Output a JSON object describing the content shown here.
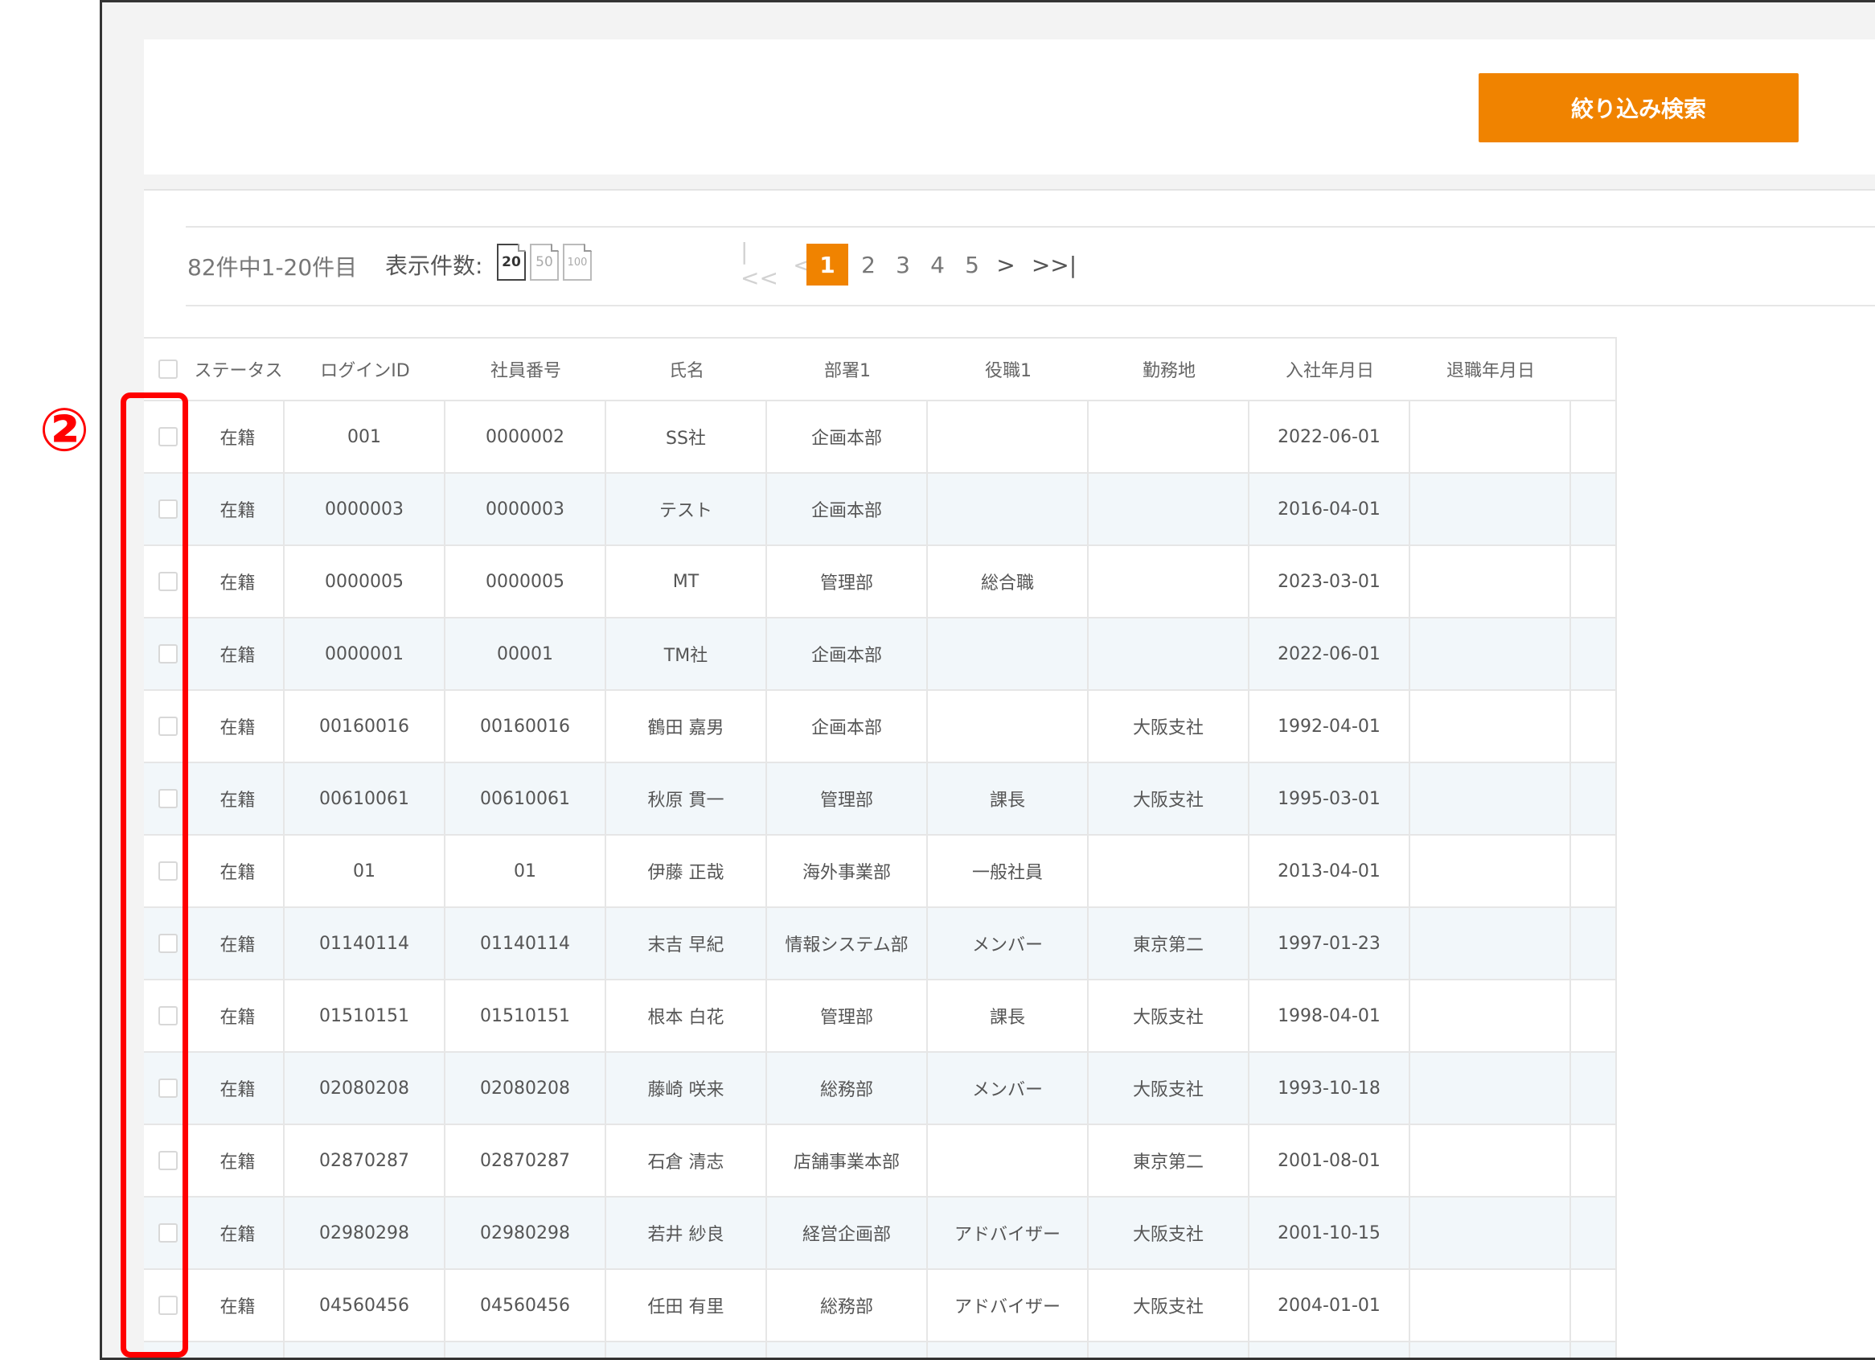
{
  "annotation": {
    "marker": "②"
  },
  "search_panel": {
    "filter_button_label": "絞り込み検索"
  },
  "toolbar": {
    "result_count": "82件中1-20件目",
    "per_page_label": "表示件数:",
    "page_sizes": [
      "20",
      "50",
      "100"
    ],
    "active_page_size": "20"
  },
  "pagination": {
    "first_label": "|<<",
    "prev_label": "<",
    "pages": [
      "1",
      "2",
      "3",
      "4",
      "5"
    ],
    "current_page": "1",
    "next_label": ">",
    "last_label": ">>|"
  },
  "table": {
    "columns": [
      "ステータス",
      "ログインID",
      "社員番号",
      "氏名",
      "部署1",
      "役職1",
      "勤務地",
      "入社年月日",
      "退職年月日"
    ],
    "rows": [
      [
        "在籍",
        "001",
        "0000002",
        "SS社",
        "企画本部",
        "",
        "",
        "2022-06-01",
        ""
      ],
      [
        "在籍",
        "0000003",
        "0000003",
        "テスト",
        "企画本部",
        "",
        "",
        "2016-04-01",
        ""
      ],
      [
        "在籍",
        "0000005",
        "0000005",
        "MT",
        "管理部",
        "総合職",
        "",
        "2023-03-01",
        ""
      ],
      [
        "在籍",
        "0000001",
        "00001",
        "TM社",
        "企画本部",
        "",
        "",
        "2022-06-01",
        ""
      ],
      [
        "在籍",
        "00160016",
        "00160016",
        "鶴田 嘉男",
        "企画本部",
        "",
        "大阪支社",
        "1992-04-01",
        ""
      ],
      [
        "在籍",
        "00610061",
        "00610061",
        "秋原 貫一",
        "管理部",
        "課長",
        "大阪支社",
        "1995-03-01",
        ""
      ],
      [
        "在籍",
        "01",
        "01",
        "伊藤 正哉",
        "海外事業部",
        "一般社員",
        "",
        "2013-04-01",
        ""
      ],
      [
        "在籍",
        "01140114",
        "01140114",
        "末吉 早紀",
        "情報システム部",
        "メンバー",
        "東京第二",
        "1997-01-23",
        ""
      ],
      [
        "在籍",
        "01510151",
        "01510151",
        "根本 白花",
        "管理部",
        "課長",
        "大阪支社",
        "1998-04-01",
        ""
      ],
      [
        "在籍",
        "02080208",
        "02080208",
        "藤崎 咲来",
        "総務部",
        "メンバー",
        "大阪支社",
        "1993-10-18",
        ""
      ],
      [
        "在籍",
        "02870287",
        "02870287",
        "石倉 清志",
        "店舗事業本部",
        "",
        "東京第二",
        "2001-08-01",
        ""
      ],
      [
        "在籍",
        "02980298",
        "02980298",
        "若井 紗良",
        "経営企画部",
        "アドバイザー",
        "大阪支社",
        "2001-10-15",
        ""
      ],
      [
        "在籍",
        "04560456",
        "04560456",
        "任田 有里",
        "総務部",
        "アドバイザー",
        "大阪支社",
        "2004-01-01",
        ""
      ],
      [
        "",
        "",
        "",
        "",
        "",
        "",
        "",
        "",
        ""
      ]
    ]
  },
  "colors": {
    "accent": "#f08300",
    "highlight": "#ff0000",
    "row_stripe": "#f2f7fa"
  }
}
